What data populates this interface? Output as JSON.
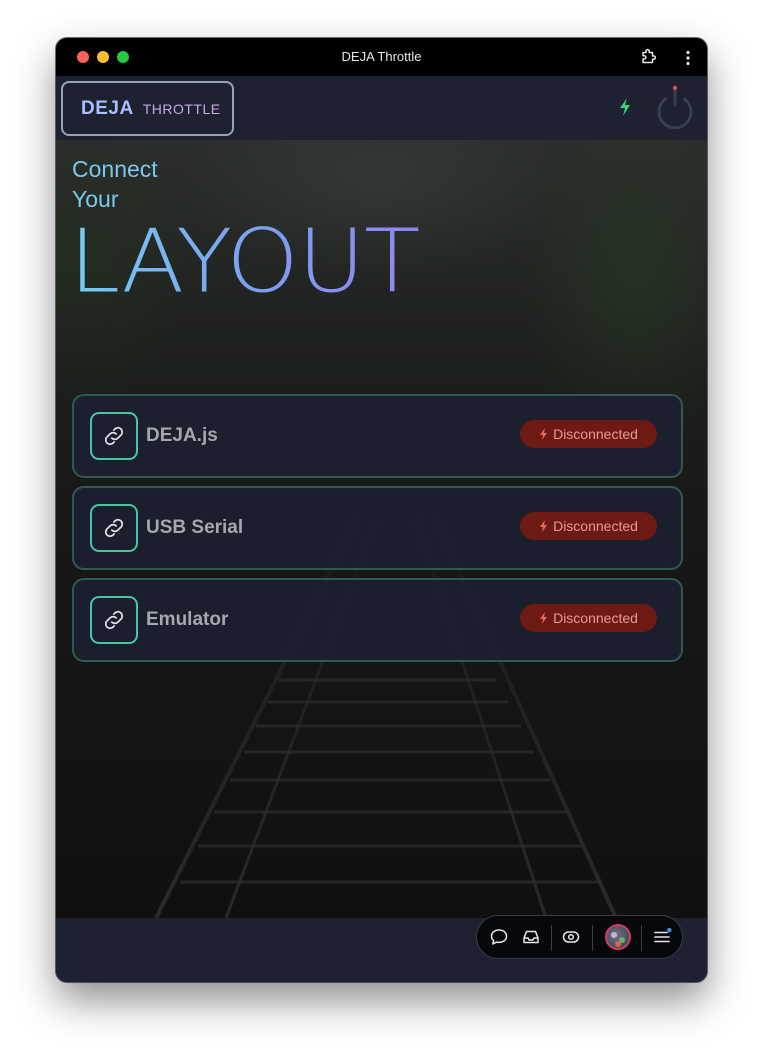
{
  "window": {
    "title": "DEJA Throttle"
  },
  "header": {
    "brand": "DEJA",
    "product": "THROTTLE"
  },
  "hero": {
    "line1": "Connect",
    "line2": "Your",
    "big": "LAYOUT"
  },
  "connections": [
    {
      "label": "DEJA.js",
      "status": "Disconnected",
      "icon": "link-icon"
    },
    {
      "label": "USB Serial",
      "status": "Disconnected",
      "icon": "link-icon"
    },
    {
      "label": "Emulator",
      "status": "Disconnected",
      "icon": "link-icon"
    }
  ],
  "dock": {
    "items": [
      "chat-icon",
      "inbox-icon",
      "eye-icon",
      "avatar",
      "menu-icon"
    ]
  },
  "colors": {
    "accent_teal": "#4cc4a4",
    "status_error_bg": "#6e1a14",
    "status_error_text": "#e89a8f",
    "bolt_green": "#39d47a",
    "power_red": "#e0503e"
  }
}
